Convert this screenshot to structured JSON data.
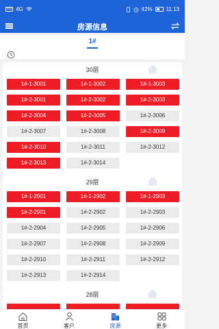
{
  "status_bar": {
    "chip_label": "HD",
    "signal": "4G",
    "battery": "42%",
    "time": "11:13"
  },
  "nav": {
    "title": "房源信息"
  },
  "building": {
    "name": "1#"
  },
  "floors": [
    {
      "label": "30层",
      "rooms": [
        {
          "name": "1#-1-3001",
          "status": "sold"
        },
        {
          "name": "1#-1-3002",
          "status": "sold"
        },
        {
          "name": "1#-1-3003",
          "status": "sold"
        },
        {
          "name": "1#-2-3001",
          "status": "sold"
        },
        {
          "name": "1#-2-3002",
          "status": "sold"
        },
        {
          "name": "1#-2-3003",
          "status": "sold"
        },
        {
          "name": "1#-2-3004",
          "status": "sold"
        },
        {
          "name": "1#-2-3005",
          "status": "sold"
        },
        {
          "name": "1#-2-3006",
          "status": "free"
        },
        {
          "name": "1#-2-3007",
          "status": "free"
        },
        {
          "name": "1#-2-3008",
          "status": "free"
        },
        {
          "name": "1#-2-3009",
          "status": "sold"
        },
        {
          "name": "1#-2-3010",
          "status": "sold"
        },
        {
          "name": "1#-2-3011",
          "status": "free"
        },
        {
          "name": "1#-2-3012",
          "status": "free"
        },
        {
          "name": "1#-2-3013",
          "status": "sold"
        },
        {
          "name": "1#-2-3014",
          "status": "free"
        }
      ]
    },
    {
      "label": "29层",
      "rooms": [
        {
          "name": "1#-1-2901",
          "status": "sold"
        },
        {
          "name": "1#-1-2902",
          "status": "sold"
        },
        {
          "name": "1#-1-2903",
          "status": "sold"
        },
        {
          "name": "1#-2-2901",
          "status": "sold"
        },
        {
          "name": "1#-2-2902",
          "status": "free"
        },
        {
          "name": "1#-2-2903",
          "status": "free"
        },
        {
          "name": "1#-2-2904",
          "status": "free"
        },
        {
          "name": "1#-2-2905",
          "status": "free"
        },
        {
          "name": "1#-2-2906",
          "status": "free"
        },
        {
          "name": "1#-2-2907",
          "status": "free"
        },
        {
          "name": "1#-2-2908",
          "status": "free"
        },
        {
          "name": "1#-2-2909",
          "status": "free"
        },
        {
          "name": "1#-2-2910",
          "status": "free"
        },
        {
          "name": "1#-2-2911",
          "status": "free"
        },
        {
          "name": "1#-2-2912",
          "status": "free"
        },
        {
          "name": "1#-2-2913",
          "status": "free"
        },
        {
          "name": "1#-2-2914",
          "status": "free"
        }
      ]
    },
    {
      "label": "28层",
      "rooms": [
        {
          "name": "",
          "status": "sold"
        },
        {
          "name": "",
          "status": "sold"
        },
        {
          "name": "",
          "status": "sold"
        }
      ]
    }
  ],
  "tabs": [
    {
      "label": "首页",
      "icon": "home-icon",
      "active": false
    },
    {
      "label": "客户",
      "icon": "customer-icon",
      "active": false
    },
    {
      "label": "房源",
      "icon": "building-icon",
      "active": true
    },
    {
      "label": "更多",
      "icon": "more-icon",
      "active": false
    }
  ],
  "colors": {
    "primary": "#1e63d8",
    "sold": "#ee1c25",
    "available": "#ebebeb"
  }
}
